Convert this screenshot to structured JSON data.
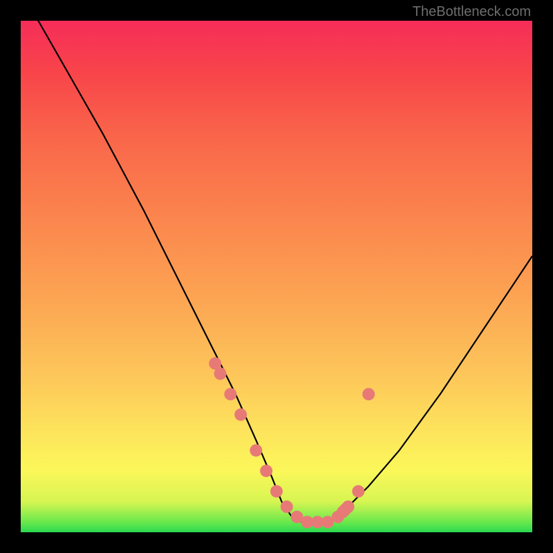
{
  "watermark": "TheBottleneck.com",
  "chart_data": {
    "type": "line",
    "title": "",
    "xlabel": "",
    "ylabel": "",
    "xlim": [
      0,
      100
    ],
    "ylim": [
      0,
      100
    ],
    "series": [
      {
        "name": "bottleneck-curve",
        "x": [
          0,
          8,
          16,
          24,
          31,
          37,
          42,
          46,
          49,
          51,
          53,
          55,
          58,
          62,
          64,
          68,
          74,
          82,
          90,
          100
        ],
        "values": [
          106,
          92,
          78,
          63,
          49,
          37,
          27,
          18,
          11,
          6,
          3,
          2,
          2,
          3,
          5,
          9,
          16,
          27,
          39,
          54
        ]
      }
    ],
    "markers": {
      "name": "highlight-dots",
      "color": "#e77a77",
      "x": [
        38,
        39,
        41,
        43,
        46,
        48,
        50,
        52,
        54,
        56,
        58,
        60,
        62,
        63,
        63.5,
        64,
        66,
        68
      ],
      "values": [
        33,
        31,
        27,
        23,
        16,
        12,
        8,
        5,
        3,
        2,
        2,
        2,
        3,
        4,
        4.5,
        5,
        8,
        27
      ]
    }
  }
}
